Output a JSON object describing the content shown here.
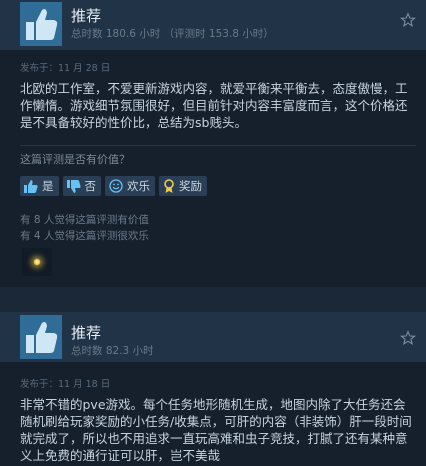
{
  "reviews": [
    {
      "verdict": "推荐",
      "hours": "总时数 180.6 小时 （评测时 153.8 小时）",
      "posted": "发布于：11 月 28 日",
      "body": "北欧的工作室，不爱更新游戏内容，就爱平衡来平衡去，态度傲慢，工作懒惰。游戏细节氛围很好，但目前针对内容丰富度而言，这个价格还是不具备较好的性价比，总结为sb贱头。",
      "helpful_question": "这篇评测是否有价值？",
      "buttons": {
        "yes": "是",
        "no": "否",
        "funny": "欢乐",
        "award": "奖励"
      },
      "helpful_count": "有 8 人觉得这篇评测有价值",
      "funny_count": "有 4 人觉得这篇评测很欢乐"
    },
    {
      "verdict": "推荐",
      "hours": "总时数 82.3 小时",
      "posted": "发布于：11 月 18 日",
      "body": "非常不错的pve游戏。每个任务地形随机生成，地图内除了大任务还会随机刷给玩家奖励的小任务/收集点，可肝的内容（非装饰）肝一段时间就完成了，所以也不用追求一直玩高难和虫子竞技，打腻了还有某种意义上免费的通行证可以肝，岂不美哉"
    }
  ],
  "colors": {
    "accent": "#67c1f5",
    "award": "#f2c94c"
  },
  "icons": [
    "thumbs-up-icon",
    "star-icon",
    "thumbs-down-icon",
    "smile-icon",
    "award-icon"
  ]
}
